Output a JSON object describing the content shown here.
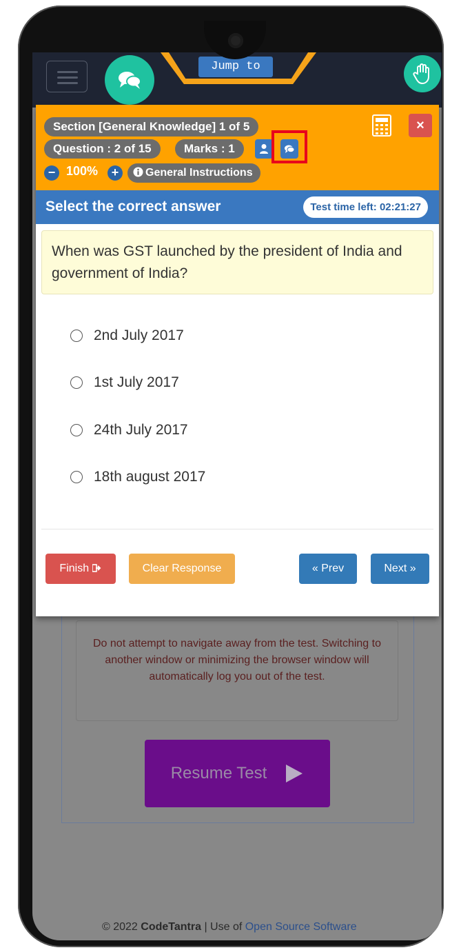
{
  "topbar": {
    "jump_label": "Jump to"
  },
  "header": {
    "section": "Section [General Knowledge] 1 of 5",
    "question_counter": "Question : 2 of 15",
    "marks": "Marks : 1",
    "zoom_value": "100%",
    "general_instructions": "General Instructions",
    "close_label": "×"
  },
  "prompt_bar": {
    "title": "Select the correct answer",
    "timer": "Test time left: 02:21:27"
  },
  "question": {
    "text": "When was GST launched by the president of India and government of India?",
    "options": [
      "2nd July 2017",
      "1st July 2017",
      "24th July 2017",
      "18th august 2017"
    ]
  },
  "actions": {
    "finish": "Finish",
    "clear": "Clear Response",
    "prev": "« Prev",
    "next": "Next »"
  },
  "background": {
    "warning": "Do not attempt to navigate away from the test. Switching to another window or minimizing the browser window will automatically log you out of the test.",
    "resume": "Resume Test",
    "footer_prefix": "© 2022 ",
    "footer_brand": "CodeTantra",
    "footer_mid": " | Use of ",
    "footer_link": "Open Source Software"
  },
  "colors": {
    "header_orange": "#ffa200",
    "prompt_blue": "#3a78c0",
    "finish_red": "#d9534f",
    "clear_orange": "#f0ad4e",
    "nav_blue": "#337ab7",
    "chat_green": "#1fc2a0",
    "resume_purple": "#6a0d8a",
    "highlight_red": "#e8001c"
  },
  "icons": [
    "menu-icon",
    "chat-icon",
    "hand-icon",
    "calculator-icon",
    "close-icon",
    "user-icon",
    "comment-icon",
    "zoom-out-icon",
    "zoom-in-icon",
    "info-icon",
    "sign-out-icon",
    "play-icon"
  ]
}
